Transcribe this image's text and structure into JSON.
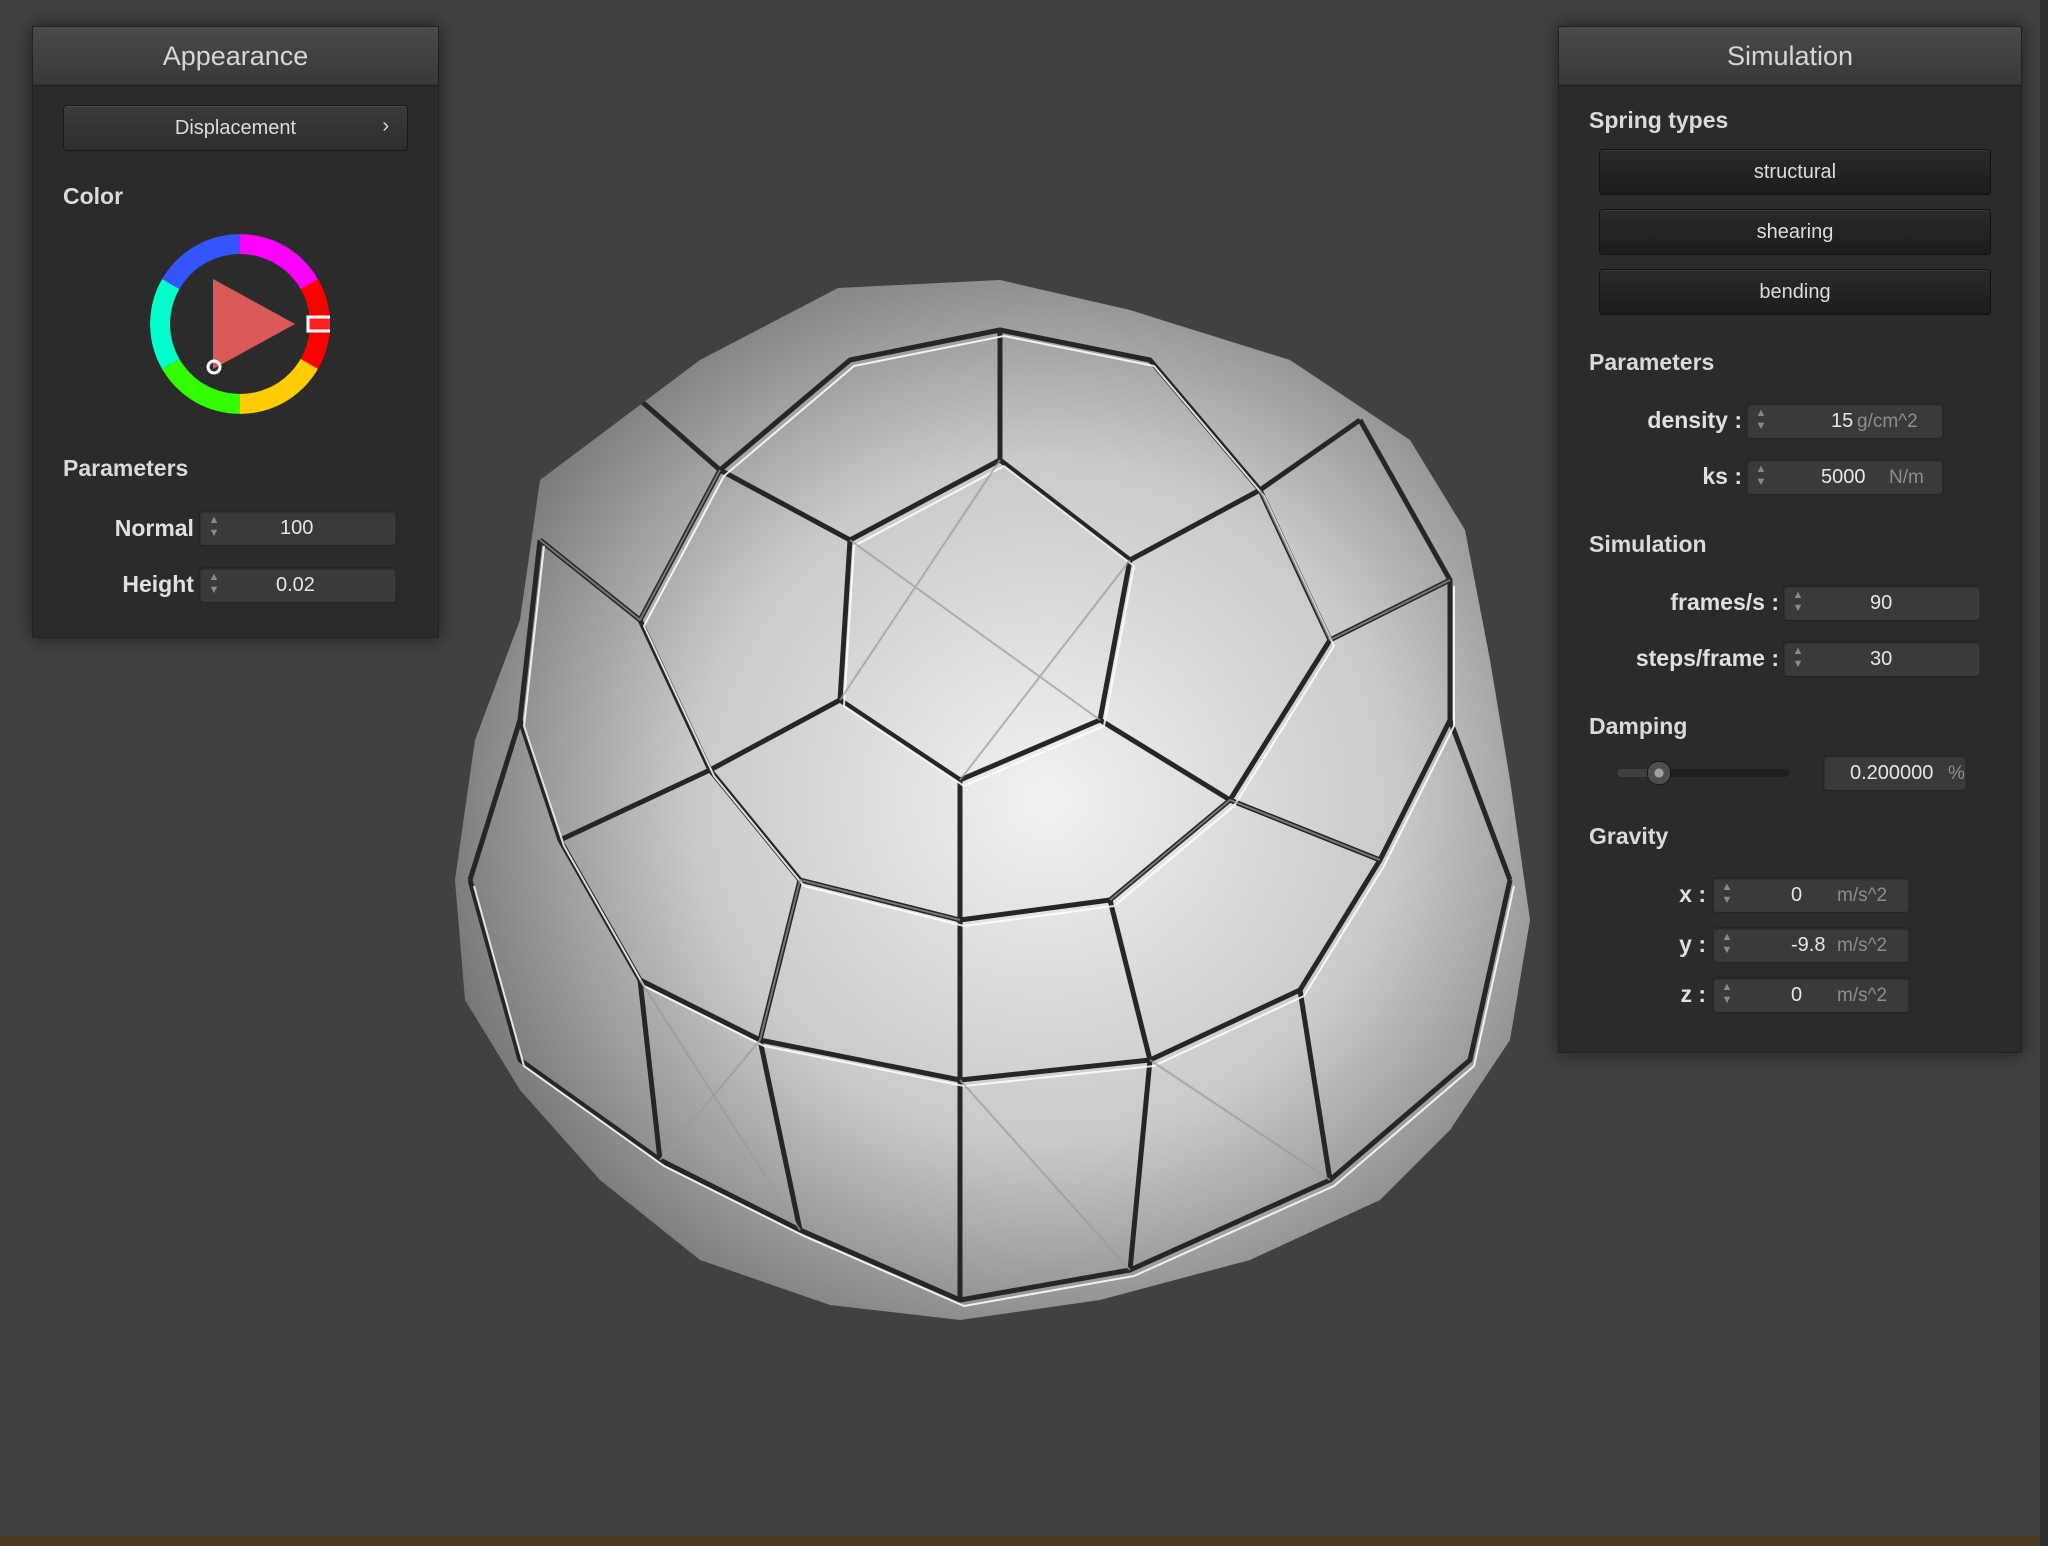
{
  "appearance": {
    "title": "Appearance",
    "shader_dropdown": {
      "label": "Displacement",
      "chevron": "›"
    },
    "color_label": "Color",
    "color_wheel": {
      "hue_color": "#ff0000"
    },
    "parameters_label": "Parameters",
    "normal": {
      "label": "Normal :",
      "value": "100"
    },
    "height": {
      "label": "Height :",
      "value": "0.02"
    }
  },
  "simulation": {
    "title": "Simulation",
    "spring_types_label": "Spring types",
    "spring_buttons": [
      {
        "label": "structural"
      },
      {
        "label": "shearing"
      },
      {
        "label": "bending"
      }
    ],
    "parameters_label": "Parameters",
    "density": {
      "label": "density :",
      "value": "15",
      "unit": "g/cm^2"
    },
    "ks": {
      "label": "ks :",
      "value": "5000",
      "unit": "N/m"
    },
    "simulation_label": "Simulation",
    "frames_per_second": {
      "label": "frames/s :",
      "value": "90"
    },
    "steps_per_frame": {
      "label": "steps/frame :",
      "value": "30"
    },
    "damping_label": "Damping",
    "damping": {
      "value": "0.200000",
      "unit": "%",
      "slider_fraction": 0.2
    },
    "gravity_label": "Gravity",
    "gravity": [
      {
        "label": "x :",
        "value": "0",
        "unit": "m/s^2"
      },
      {
        "label": "y :",
        "value": "-9.8",
        "unit": "m/s^2"
      },
      {
        "label": "z :",
        "value": "0",
        "unit": "m/s^2"
      }
    ]
  },
  "icons": {
    "spinner": "spinner-arrows-icon",
    "chevron": "chevron-right-icon"
  }
}
